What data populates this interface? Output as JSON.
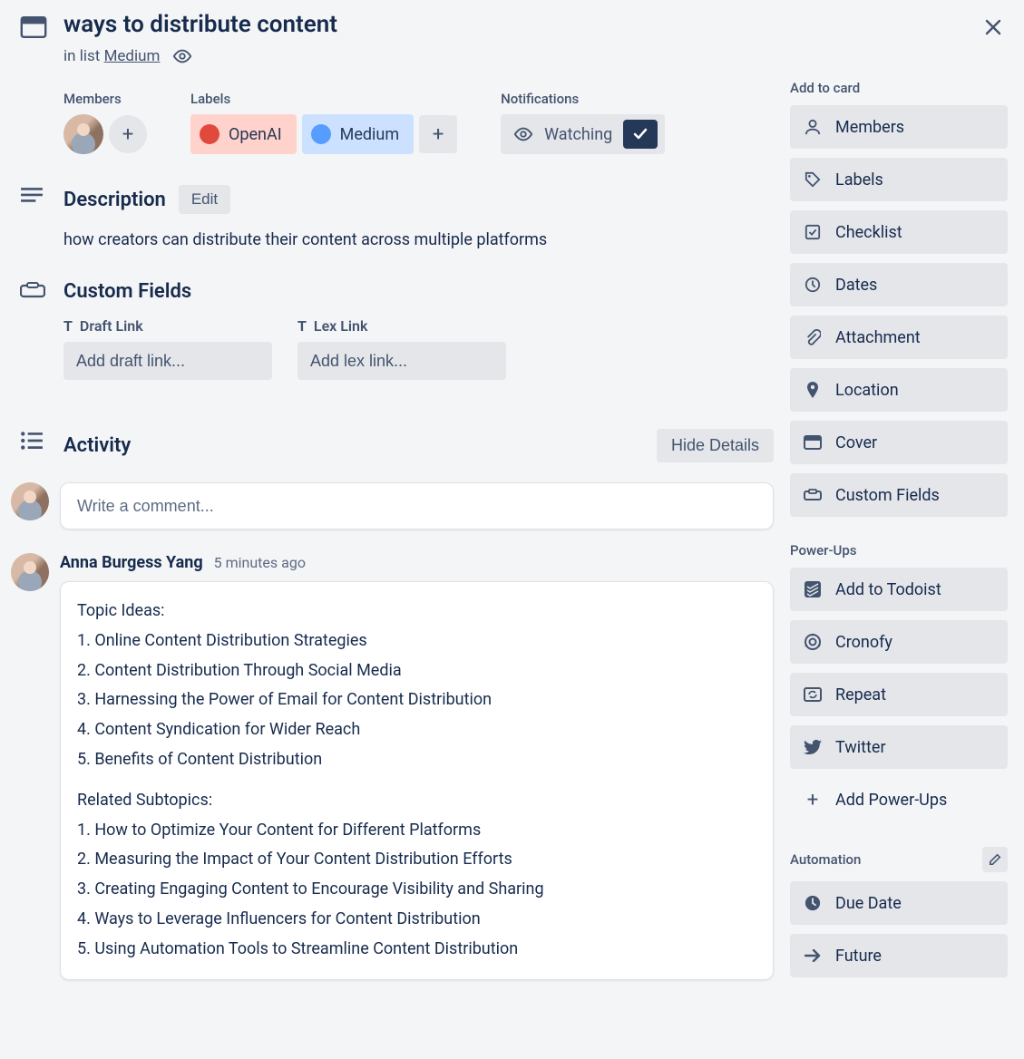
{
  "title": "ways to distribute content",
  "in_list_prefix": "in list ",
  "list_name": "Medium",
  "meta": {
    "members_label": "Members",
    "labels_label": "Labels",
    "notifications_label": "Notifications",
    "label_openai": "OpenAI",
    "label_medium": "Medium",
    "watching": "Watching"
  },
  "description": {
    "heading": "Description",
    "edit": "Edit",
    "text": "how creators can distribute their content across multiple platforms"
  },
  "custom_fields": {
    "heading": "Custom Fields",
    "draft_label": "Draft Link",
    "draft_placeholder": "Add draft link...",
    "lex_label": "Lex Link",
    "lex_placeholder": "Add lex link..."
  },
  "activity": {
    "heading": "Activity",
    "hide_details": "Hide Details",
    "compose_placeholder": "Write a comment...",
    "item": {
      "author": "Anna Burgess Yang",
      "time": "5 minutes ago",
      "lines": {
        "t0": "Topic Ideas:",
        "t1": "1. Online Content Distribution Strategies",
        "t2": "2. Content Distribution Through Social Media",
        "t3": "3. Harnessing the Power of Email for Content Distribution",
        "t4": "4. Content Syndication for Wider Reach",
        "t5": "5. Benefits of Content Distribution",
        "s0": "Related Subtopics:",
        "s1": "1. How to Optimize Your Content for Different Platforms",
        "s2": "2. Measuring the Impact of Your Content Distribution Efforts",
        "s3": "3. Creating Engaging Content to Encourage Visibility and Sharing",
        "s4": "4. Ways to Leverage Influencers for Content Distribution",
        "s5": "5. Using Automation Tools to Streamline Content Distribution"
      }
    }
  },
  "sidebar": {
    "add_to_card": "Add to card",
    "members": "Members",
    "labels": "Labels",
    "checklist": "Checklist",
    "dates": "Dates",
    "attachment": "Attachment",
    "location": "Location",
    "cover": "Cover",
    "custom_fields": "Custom Fields",
    "powerups": "Power-Ups",
    "add_to_todoist": "Add to Todoist",
    "cronofy": "Cronofy",
    "repeat": "Repeat",
    "twitter": "Twitter",
    "add_powerups": "Add Power-Ups",
    "automation": "Automation",
    "due_date": "Due Date",
    "future": "Future"
  }
}
